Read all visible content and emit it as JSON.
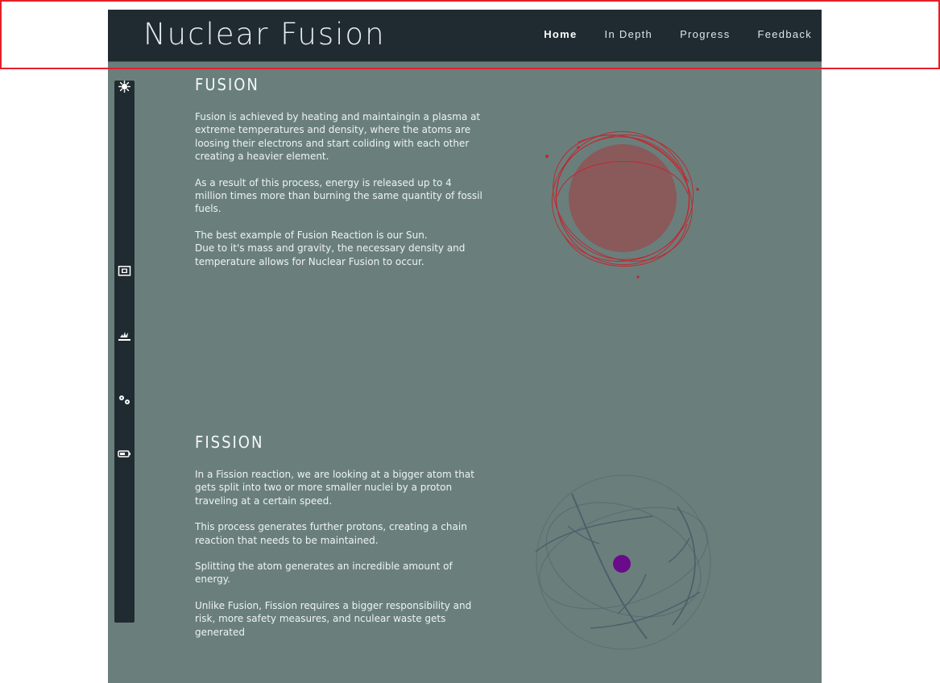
{
  "header": {
    "brand": "Nuclear Fusion",
    "nav": [
      {
        "label": "Home",
        "active": true
      },
      {
        "label": "In Depth",
        "active": false
      },
      {
        "label": "Progress",
        "active": false
      },
      {
        "label": "Feedback",
        "active": false
      }
    ]
  },
  "sidebar": {
    "icons": [
      {
        "name": "sun-icon"
      },
      {
        "name": "screen-icon"
      },
      {
        "name": "explosion-icon"
      },
      {
        "name": "gears-icon"
      },
      {
        "name": "battery-icon"
      }
    ]
  },
  "sections": [
    {
      "title": "FUSION",
      "paragraphs": [
        "Fusion is achieved by heating and maintaingin a plasma at extreme temperatures and density, where the atoms are loosing their electrons and start coliding with each other creating a heavier element.",
        "As a result of this process, energy is released up to 4 million times more than burning the same quantity of fossil fuels.",
        "The best example of Fusion Reaction is our Sun.",
        "Due to it's mass and gravity, the necessary density and temperature allows for Nuclear Fusion to occur."
      ]
    },
    {
      "title": "FISSION",
      "paragraphs": [
        "In a Fission reaction, we are looking at a bigger atom that gets split into two or more smaller nuclei by a proton traveling at a certain speed.",
        "This process generates further protons, creating a chain reaction that needs to be maintained.",
        "Splitting the atom generates an incredible amount of energy.",
        "Unlike Fusion, Fission requires a bigger responsibility and risk, more safety measures, and nculear waste gets generated"
      ]
    }
  ],
  "colors": {
    "header_bg": "#202b31",
    "page_bg": "#6a7f7c",
    "sidebar_bg": "#202b31",
    "text": "#eef3f4",
    "fusion_core": "#8a5a5b",
    "fusion_orbit": "#c3262f",
    "fission_orbit": "#4a5a68",
    "fission_core": "#6a0b8a",
    "highlight": "#e3202a"
  }
}
